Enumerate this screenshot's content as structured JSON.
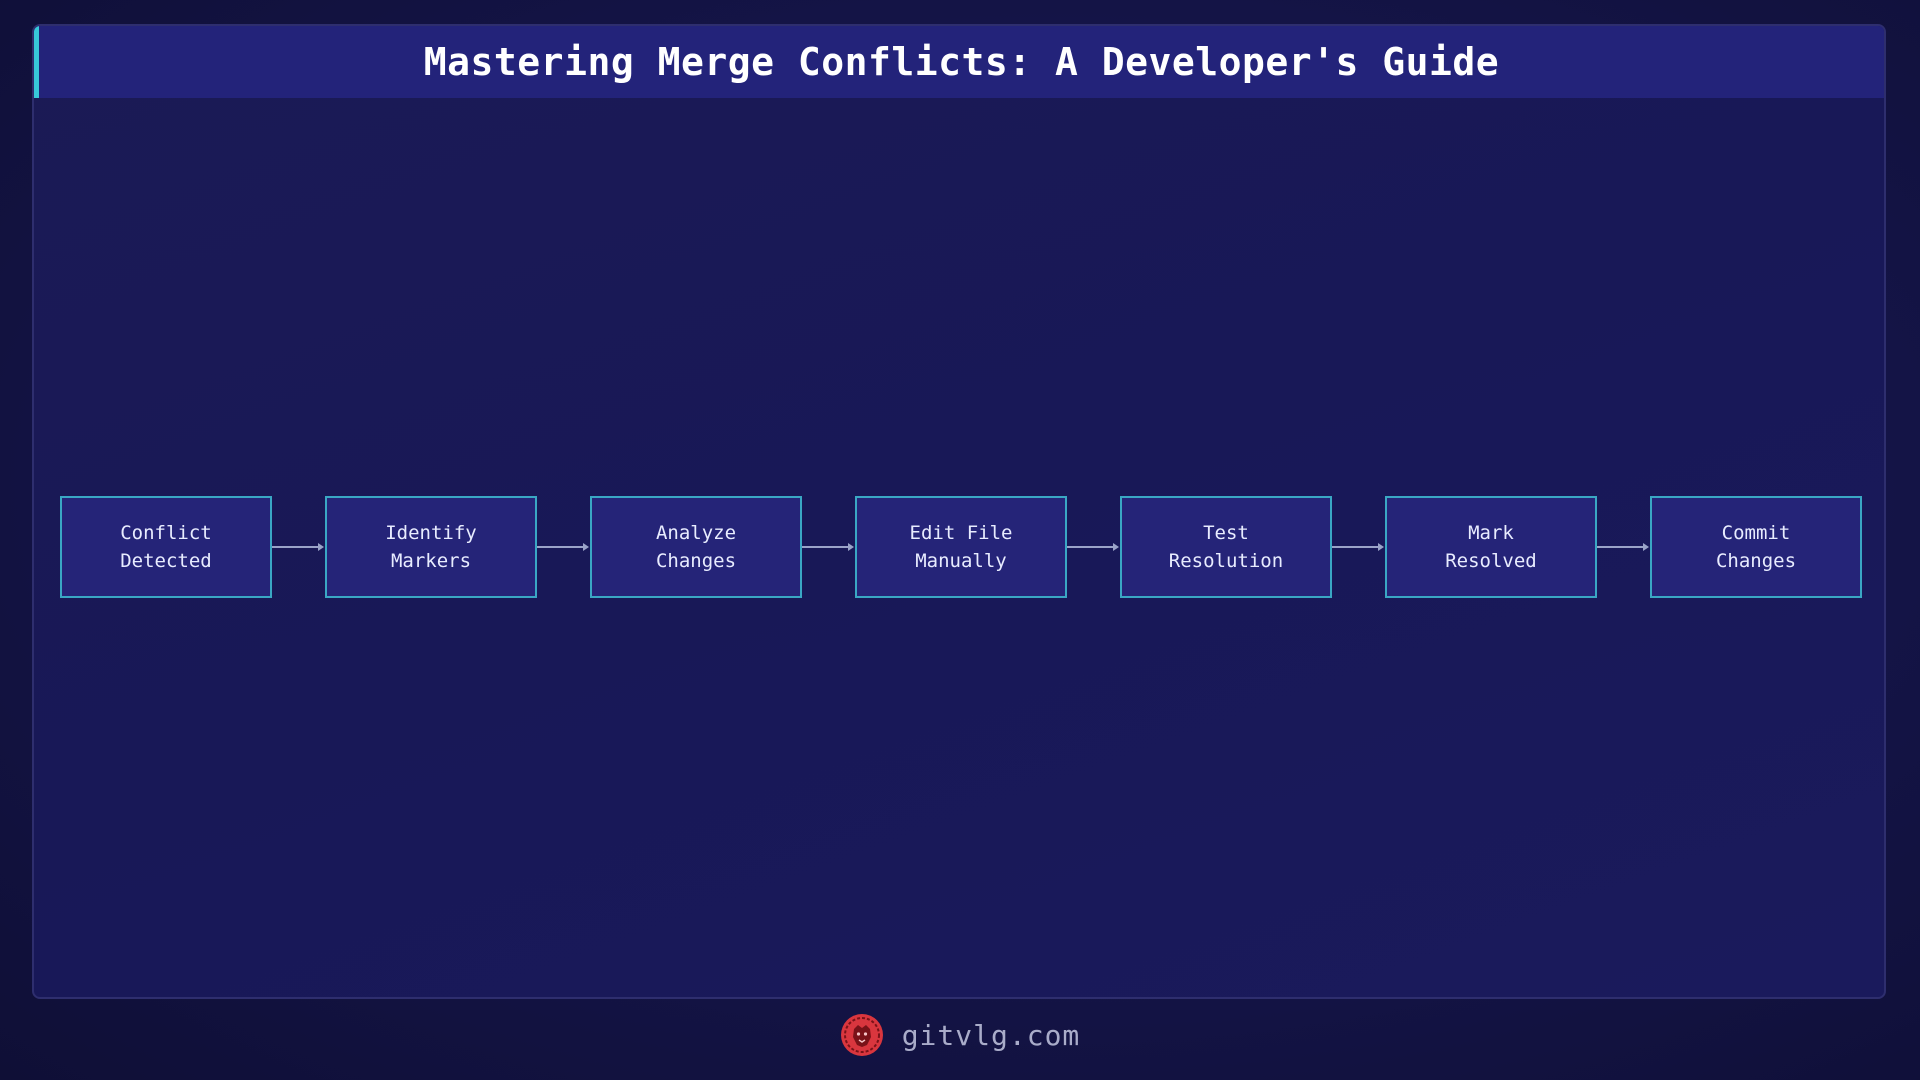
{
  "title": "Mastering Merge Conflicts: A Developer's Guide",
  "steps": [
    {
      "label": "Conflict\nDetected"
    },
    {
      "label": "Identify\nMarkers"
    },
    {
      "label": "Analyze\nChanges"
    },
    {
      "label": "Edit File\nManually"
    },
    {
      "label": "Test\nResolution"
    },
    {
      "label": "Mark\nResolved"
    },
    {
      "label": "Commit\nChanges"
    }
  ],
  "footer": {
    "site": "gitvlg.com",
    "logo_icon": "lion-head-icon"
  },
  "colors": {
    "accent": "#37c8d9",
    "box_border": "#3aa7c4",
    "box_fill": "#252478",
    "logo": "#d9363e"
  }
}
